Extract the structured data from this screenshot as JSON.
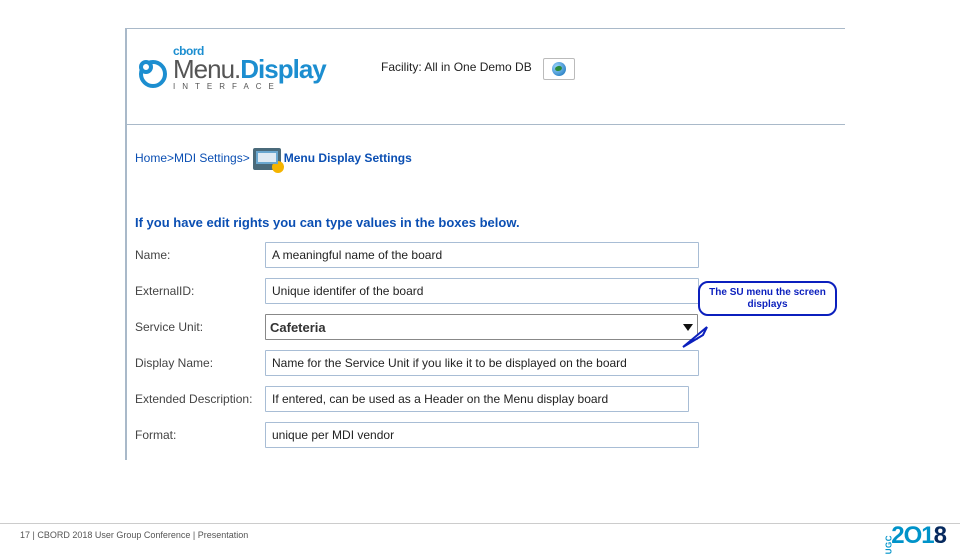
{
  "logo": {
    "brand_top": "cbord",
    "brand_main_1": "Menu.",
    "brand_main_2": "Display",
    "brand_sub": "INTERFACE"
  },
  "facility": {
    "label": "Facility:",
    "value": "All in One Demo DB"
  },
  "crumb": {
    "home": "Home",
    "settings": "MDI Settings",
    "current": "Menu Display Settings"
  },
  "intro": "If you have edit rights you can type values in the boxes below.",
  "form": {
    "name": {
      "label": "Name:",
      "value": "A meaningful name of the board"
    },
    "external_id": {
      "label": "ExternalID:",
      "value": "Unique identifer of the board"
    },
    "service_unit": {
      "label": "Service Unit:",
      "value": "Cafeteria"
    },
    "display_name": {
      "label": "Display Name:",
      "value": "Name for the Service Unit if you like it to be displayed on the board"
    },
    "extended_desc": {
      "label": "Extended Description:",
      "value": "If entered, can be used as a Header on the Menu display board"
    },
    "format": {
      "label": "Format:",
      "value": "unique per MDI vendor"
    }
  },
  "callout": "The SU menu the screen displays",
  "footer": {
    "page": "17",
    "sep": " | ",
    "text": "CBORD 2018 User Group Conference | Presentation",
    "ugc": "UGC",
    "year_a": "2O1",
    "year_b": "8"
  }
}
